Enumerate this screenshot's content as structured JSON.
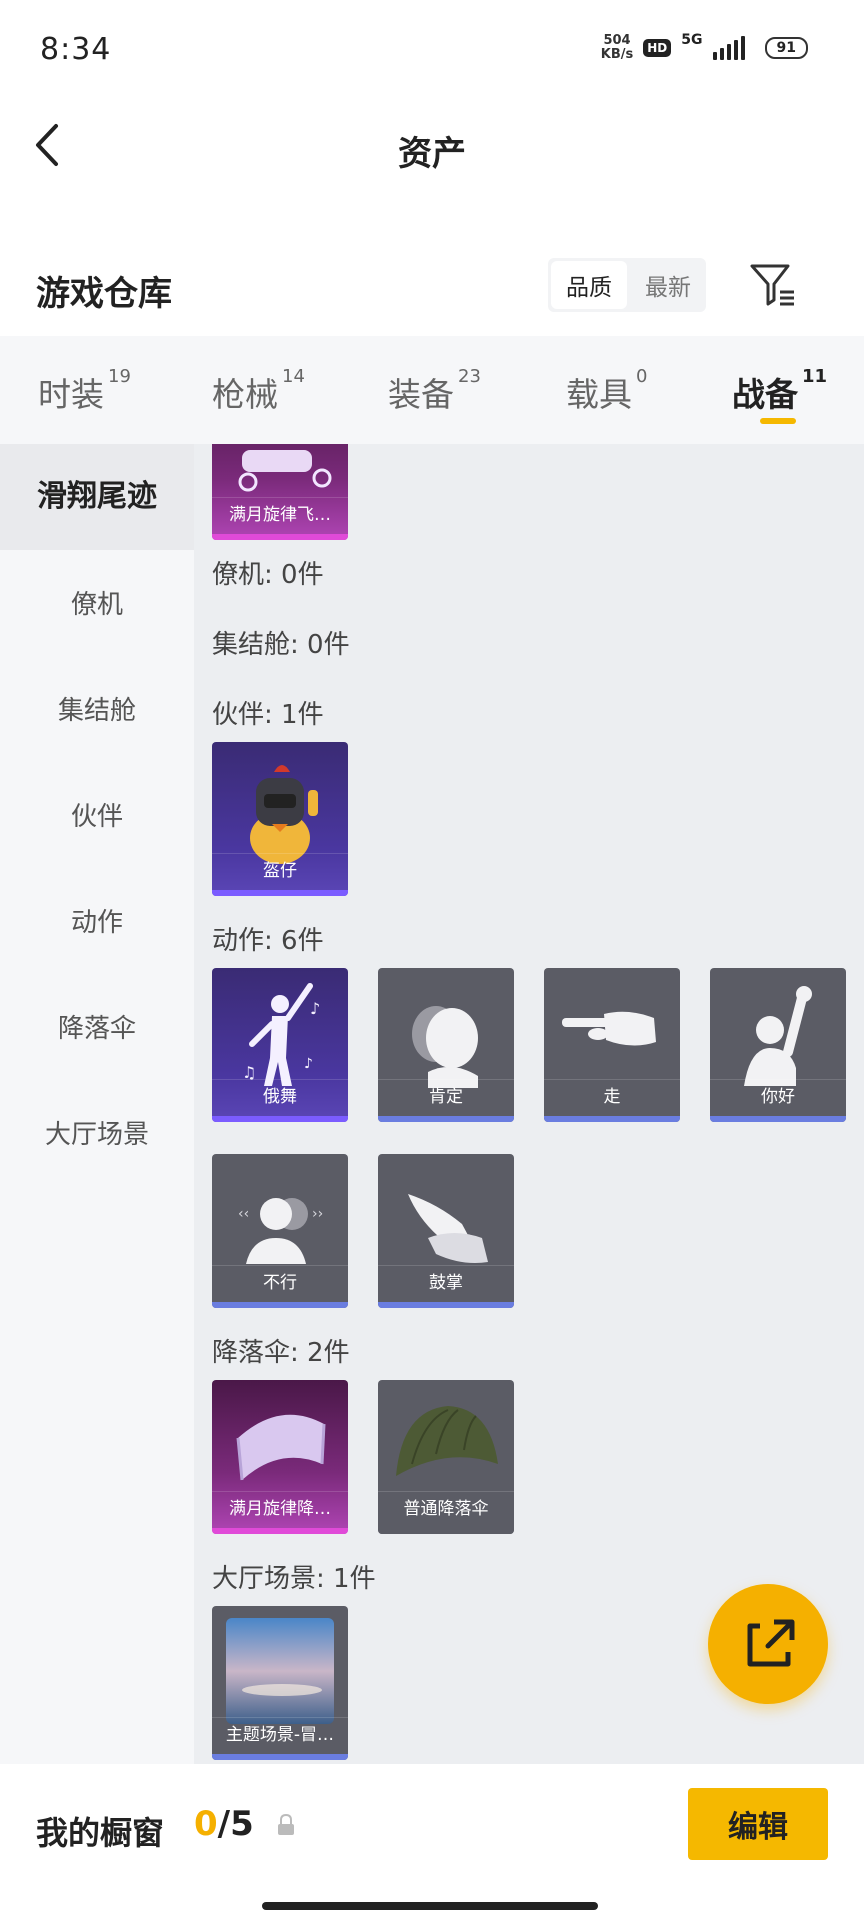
{
  "status": {
    "time": "8:34",
    "net_speed": "504",
    "net_unit": "KB/s",
    "hd": "HD",
    "network": "5G",
    "battery": "91"
  },
  "header": {
    "title": "资产"
  },
  "warehouse": {
    "title": "游戏仓库",
    "sort_quality": "品质",
    "sort_latest": "最新"
  },
  "tabs": [
    {
      "label": "时装",
      "count": "19"
    },
    {
      "label": "枪械",
      "count": "14"
    },
    {
      "label": "装备",
      "count": "23"
    },
    {
      "label": "载具",
      "count": "0"
    },
    {
      "label": "战备",
      "count": "11"
    }
  ],
  "sidebar": [
    {
      "label": "滑翔尾迹"
    },
    {
      "label": "僚机"
    },
    {
      "label": "集结舱"
    },
    {
      "label": "伙伴"
    },
    {
      "label": "动作"
    },
    {
      "label": "降落伞"
    },
    {
      "label": "大厅场景"
    }
  ],
  "sections": {
    "glide_item": "满月旋律飞…",
    "wingman": "僚机: 0件",
    "capsule": "集结舱: 0件",
    "partner": "伙伴: 1件",
    "partner_items": [
      "盔仔"
    ],
    "action": "动作: 6件",
    "action_items": [
      "俄舞",
      "肯定",
      "走",
      "你好",
      "不行",
      "鼓掌"
    ],
    "parachute": "降落伞: 2件",
    "parachute_items": [
      "满月旋律降…",
      "普通降落伞"
    ],
    "lobby": "大厅场景: 1件",
    "lobby_items": [
      "主题场景-冒…"
    ]
  },
  "bottom": {
    "title": "我的橱窗",
    "count_current": "0",
    "count_total": "/5",
    "edit_label": "编辑"
  },
  "colors": {
    "accent": "#f5b800",
    "rarity_purple": "#7b5cff",
    "rarity_pink": "#e04ad8",
    "rarity_blue": "#6a7de0"
  }
}
